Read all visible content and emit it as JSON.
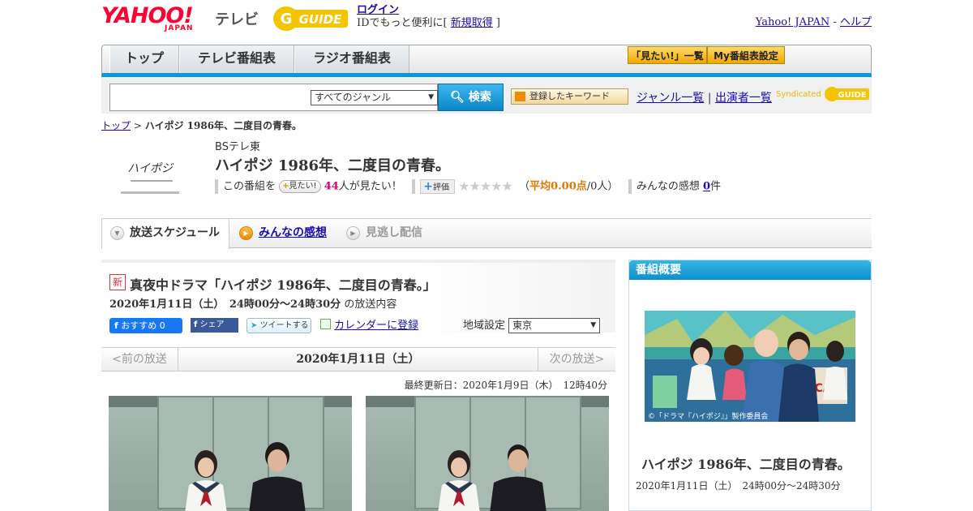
{
  "header": {
    "logo_text": "YAHOO!",
    "logo_sub": "JAPAN",
    "service": "テレビ",
    "gguide_logo": "G-GUIDE",
    "login_link": "ログイン",
    "login_pre": "IDでもっと便利に[ ",
    "signup_link": "新規取得",
    "login_post": " ]",
    "yahoo_link": "Yahoo! JAPAN",
    "help_sep": " - ",
    "help_link": "ヘルプ"
  },
  "nav": {
    "tabs": [
      "トップ",
      "テレビ番組表",
      "ラジオ番組表"
    ],
    "want_list": "「見たい!」一覧",
    "my_settings": "My番組表設定"
  },
  "search": {
    "genre": "すべてのジャンル",
    "button": "検索",
    "keyword_button": "登録したキーワード",
    "genre_list": "ジャンル一覧",
    "divider": "|",
    "cast_list": "出演者一覧",
    "syndicated": "Syndicated"
  },
  "breadcrumb": {
    "top": "トップ",
    "sep": " > ",
    "current": "ハイポジ 1986年、二度目の青春。"
  },
  "program": {
    "channel": "BSテレ東",
    "title": "ハイポジ 1986年、二度目の青春。",
    "logo_text": "ハイポジ",
    "this_program": "この番組を",
    "want_btn": "見たい!",
    "want_count": "44",
    "want_suffix": "人が見たい！",
    "rate_btn": "評価",
    "stars": "★★★★★",
    "avg_open": "（",
    "avg_label": "平均0.00点",
    "avg_people": "/0人）",
    "impressions_label": "みんなの感想",
    "impressions_count": "0",
    "impressions_unit": "件"
  },
  "subtabs": {
    "schedule": "放送スケジュール",
    "impressions": "みんなの感想",
    "missed": "見逃し配信"
  },
  "broadcast": {
    "new_badge": "新",
    "title": "真夜中ドラマ「ハイポジ 1986年、二度目の青春。」",
    "date": "2020年1月11日（土）　24時00分～24時30分",
    "date_suffix": "の放送内容",
    "fb_recommend": "おすすめ 0",
    "fb_share": "シェア",
    "tweet": "ツイートする",
    "calendar": "カレンダーに登録",
    "region_label": "地域設定",
    "region_value": "東京",
    "prev": "<前の放送",
    "current_day": "2020年1月11日（土）",
    "next": "次の放送>",
    "updated": "最終更新日：2020年1月9日（木）　12時40分"
  },
  "overview": {
    "heading": "番組概要",
    "title": "ハイポジ 1986年、二度目の青春。",
    "date": "2020年1月11日（土）　24時00分～24時30分",
    "copyright": "©「ドラマ『ハイポジ』」製作委員会"
  },
  "colors": {
    "accent_blue": "#0a98d8",
    "yahoo_red": "#ff0033",
    "want_pink": "#d6006e",
    "avg_orange": "#e07800"
  }
}
